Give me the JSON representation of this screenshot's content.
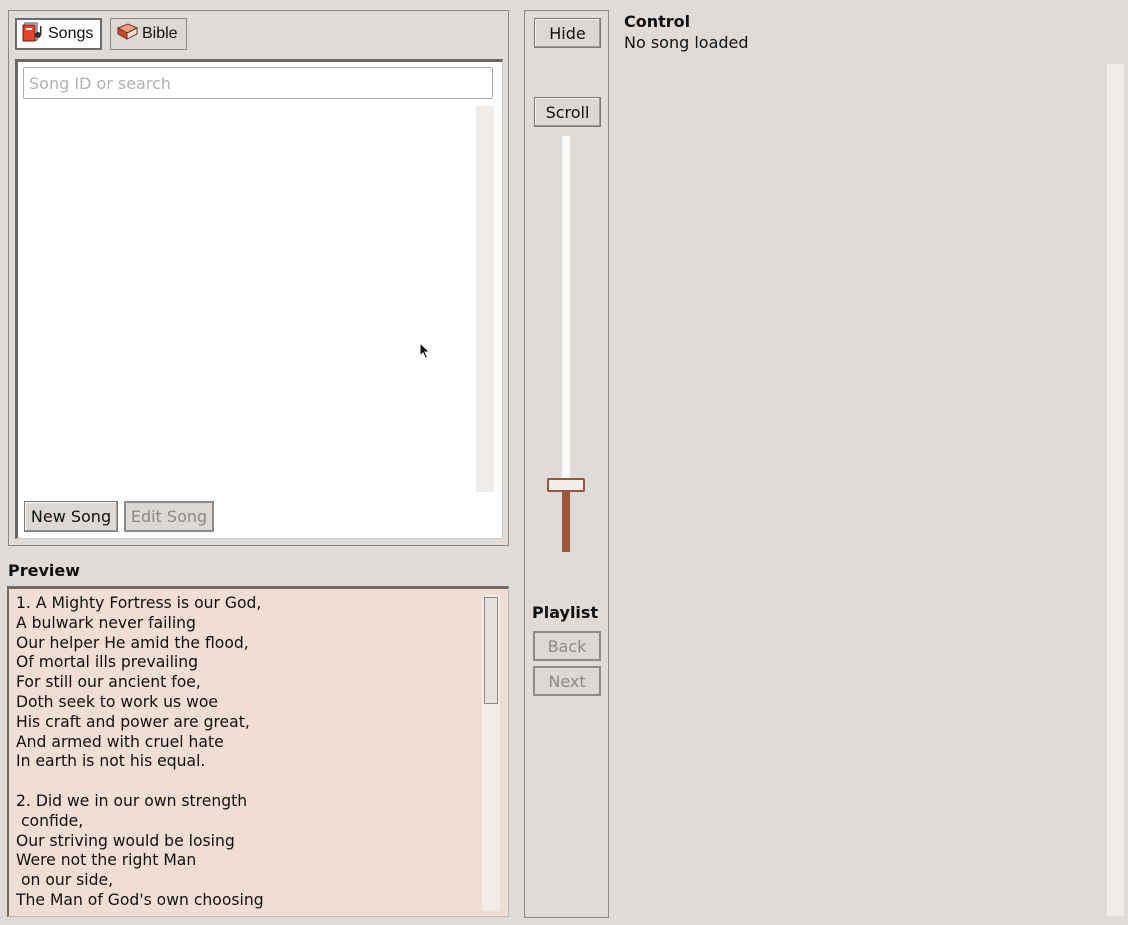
{
  "tabs": [
    {
      "label": "Songs",
      "icon": "songbook-icon",
      "active": true
    },
    {
      "label": "Bible",
      "icon": "book-icon",
      "active": false
    }
  ],
  "search": {
    "placeholder": "Song ID or search",
    "value": ""
  },
  "song_actions": {
    "new_song": "New Song",
    "edit_song": "Edit Song"
  },
  "preview": {
    "label": "Preview",
    "text": "1. A Mighty Fortress is our God,\nA bulwark never failing\nOur helper He amid the flood,\nOf mortal ills prevailing\nFor still our ancient foe,\nDoth seek to work us woe\nHis craft and power are great,\nAnd armed with cruel hate\nIn earth is not his equal.\n\n2. Did we in our own strength\n confide,\nOur striving would be losing\nWere not the right Man\n on our side,\nThe Man of God's own choosing"
  },
  "middle": {
    "hide": "Hide",
    "scroll": "Scroll",
    "playlist": "Playlist",
    "back": "Back",
    "next": "Next"
  },
  "control": {
    "title": "Control",
    "status": "No song loaded"
  },
  "colors": {
    "background": "#dfdbd8",
    "preview_bg": "#f0ddd3",
    "slider_accent": "#9c563b"
  }
}
